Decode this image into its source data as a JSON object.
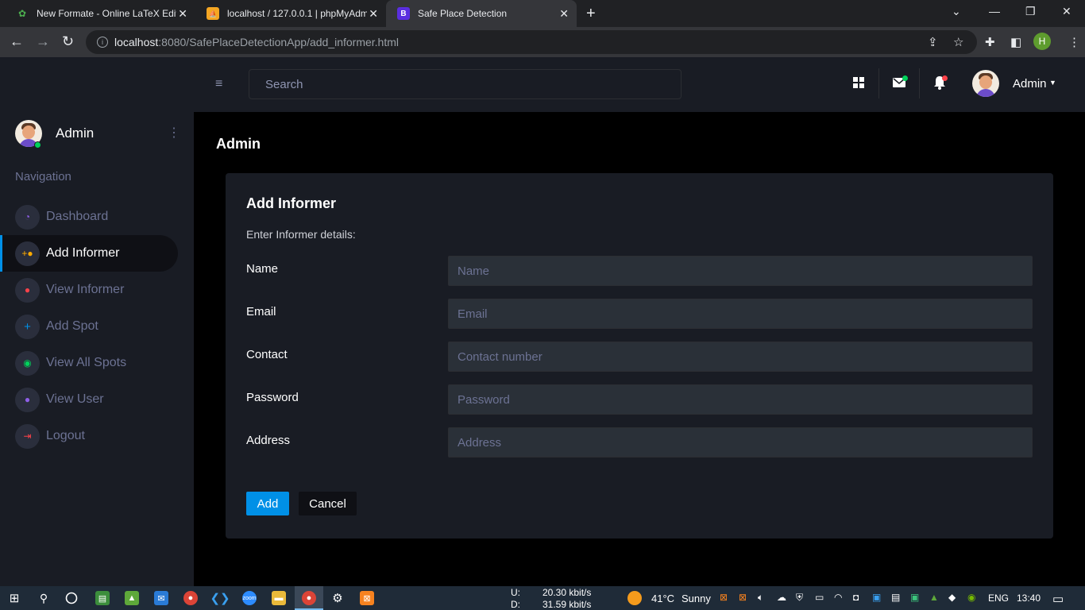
{
  "browser": {
    "tabs": [
      {
        "title": "New Formate - Online LaTeX Edit",
        "icon": "overleaf-icon",
        "active": false
      },
      {
        "title": "localhost / 127.0.0.1 | phpMyAdm",
        "icon": "phpmyadmin-icon",
        "active": false
      },
      {
        "title": "Safe Place Detection",
        "icon": "bootstrap-icon",
        "active": true
      }
    ],
    "url_host": "localhost",
    "url_rest": ":8080/SafePlaceDetectionApp/add_informer.html",
    "profile_initial": "H"
  },
  "topnav": {
    "search_placeholder": "Search",
    "user_name": "Admin"
  },
  "sidebar": {
    "user_name": "Admin",
    "nav_label": "Navigation",
    "items": [
      {
        "label": "Dashboard",
        "icon": "speedometer-icon",
        "color": "#8f5fe8",
        "active": false
      },
      {
        "label": "Add Informer",
        "icon": "add-user-icon",
        "color": "#ffab00",
        "active": true
      },
      {
        "label": "View Informer",
        "icon": "user-icon",
        "color": "#fc424a",
        "active": false
      },
      {
        "label": "Add Spot",
        "icon": "plus-icon",
        "color": "#0090e7",
        "active": false
      },
      {
        "label": "View All Spots",
        "icon": "eye-icon",
        "color": "#00d25b",
        "active": false
      },
      {
        "label": "View User",
        "icon": "user-icon",
        "color": "#8f5fe8",
        "active": false
      },
      {
        "label": "Logout",
        "icon": "logout-icon",
        "color": "#fc424a",
        "active": false
      }
    ]
  },
  "main": {
    "page_title": "Admin",
    "card_title": "Add Informer",
    "card_description": "Enter Informer details:",
    "fields": [
      {
        "label": "Name",
        "placeholder": "Name",
        "value": ""
      },
      {
        "label": "Email",
        "placeholder": "Email",
        "value": ""
      },
      {
        "label": "Contact",
        "placeholder": "Contact number",
        "value": ""
      },
      {
        "label": "Password",
        "placeholder": "Password",
        "value": ""
      },
      {
        "label": "Address",
        "placeholder": "Address",
        "value": ""
      }
    ],
    "add_label": "Add",
    "cancel_label": "Cancel"
  },
  "taskbar": {
    "net_upload_label": "U:",
    "net_download_label": "D:",
    "net_upload": "20.30 kbit/s",
    "net_download": "31.59 kbit/s",
    "temperature": "41°C",
    "weather": "Sunny",
    "language": "ENG",
    "time": "13:40"
  },
  "colors": {
    "accent": "#0090e7",
    "sidebar_bg": "#191c24",
    "input_bg": "#2a3038"
  }
}
